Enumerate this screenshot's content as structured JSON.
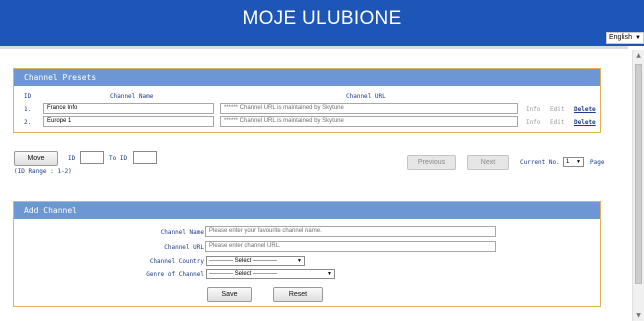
{
  "header": {
    "title": "MOJE ULUBIONE",
    "language": "English"
  },
  "presets": {
    "title": "Channel Presets",
    "columns": {
      "id": "ID",
      "name": "Channel Name",
      "url": "Channel URL"
    },
    "rows": [
      {
        "id": "1.",
        "name": "France Info",
        "url": "****** Channel URL is maintained by Skytune",
        "info": "Info",
        "edit": "Edit",
        "delete": "Delete"
      },
      {
        "id": "2.",
        "name": "Europe 1",
        "url": "****** Channel URL is maintained by Skytune",
        "info": "Info",
        "edit": "Edit",
        "delete": "Delete"
      }
    ]
  },
  "move": {
    "button": "Move",
    "id_label": "ID",
    "to_label": "To ID",
    "range": "(ID Range : 1-2)",
    "id_value": "",
    "to_value": ""
  },
  "pager": {
    "previous": "Previous",
    "next": "Next",
    "current_label": "Current No.",
    "current_value": "1",
    "page_label": "Page"
  },
  "add": {
    "title": "Add Channel",
    "name_label": "Channel Name",
    "name_placeholder": "Please enter your favourite channel name.",
    "url_label": "Channel URL",
    "url_placeholder": "Please enter channel URL.",
    "country_label": "Channel Country",
    "country_value": "------------ Select ------------",
    "genre_label": "Genre of Channel",
    "genre_value": "------------ Select ------------",
    "save": "Save",
    "reset": "Reset"
  },
  "colors": {
    "header": "#1d56b6",
    "panel_header": "#6d97d2",
    "panel_border": "#e3b35a",
    "link": "#1c3a88"
  }
}
